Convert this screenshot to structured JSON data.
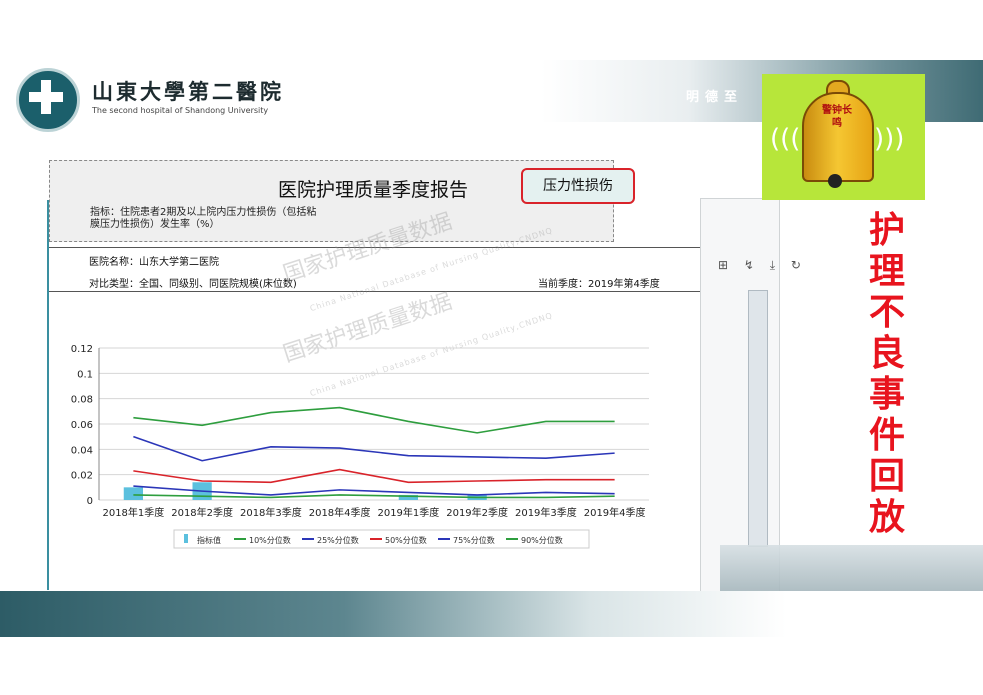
{
  "header": {
    "university_cn": "山東大學第二醫院",
    "university_en": "The second hospital of Shandong University",
    "motto": "明德至"
  },
  "bell": {
    "text": "警钟长鸣"
  },
  "side_title": "护理不良事件回放",
  "report": {
    "title": "医院护理质量季度报告",
    "tag": "压力性损伤",
    "indicator": "指标：住院患者2期及以上院内压力性损伤（包括粘膜压力性损伤）发生率（%）",
    "hospital": "医院名称：山东大学第二医院",
    "compare": "对比类型：全国、同级别、同医院规模(床位数)",
    "quarter": "当前季度：2019年第4季度",
    "watermark_cn": "国家护理质量数据",
    "watermark_en": "China National Database of Nursing Quality,CNDNQ"
  },
  "chart_data": {
    "type": "line",
    "categories": [
      "2018年1季度",
      "2018年2季度",
      "2018年3季度",
      "2018年4季度",
      "2019年1季度",
      "2019年2季度",
      "2019年3季度",
      "2019年4季度"
    ],
    "ylim": [
      0,
      0.12
    ],
    "yticks": [
      "0",
      "0.02",
      "0.04",
      "0.06",
      "0.08",
      "0.1",
      "0.12"
    ],
    "grid": true,
    "legend_position": "bottom",
    "series": [
      {
        "name": "指标值",
        "type": "bar",
        "color": "#5bc0de",
        "values": [
          0.01,
          0.014,
          0,
          0,
          0.004,
          0.004,
          0,
          0
        ]
      },
      {
        "name": "10%分位数",
        "type": "line",
        "color": "#2e9e3e",
        "values": [
          0.065,
          0.059,
          0.069,
          0.073,
          0.062,
          0.053,
          0.062,
          0.062
        ]
      },
      {
        "name": "25%分位数",
        "type": "line",
        "color": "#2b36b8",
        "values": [
          0.05,
          0.031,
          0.042,
          0.041,
          0.035,
          0.034,
          0.033,
          0.037
        ]
      },
      {
        "name": "50%分位数",
        "type": "line",
        "color": "#d9232a",
        "values": [
          0.023,
          0.015,
          0.014,
          0.024,
          0.014,
          0.015,
          0.016,
          0.016
        ]
      },
      {
        "name": "75%分位数",
        "type": "line",
        "color": "#2b36b8",
        "values": [
          0.011,
          0.007,
          0.004,
          0.008,
          0.006,
          0.004,
          0.006,
          0.005
        ]
      },
      {
        "name": "90%分位数",
        "type": "line",
        "color": "#2e9e3e",
        "values": [
          0.004,
          0.003,
          0.002,
          0.004,
          0.003,
          0.002,
          0.002,
          0.003
        ]
      }
    ]
  }
}
